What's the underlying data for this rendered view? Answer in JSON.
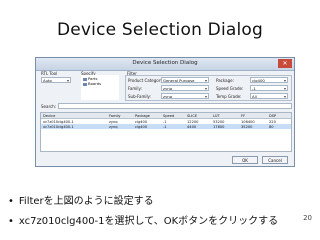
{
  "slide": {
    "title": "Device Selection Dialog",
    "page_number": "20",
    "bullets": [
      "Filterを上図のように設定する",
      "xc7z010clg400-1を選択して、OKボタンをクリックする"
    ]
  },
  "dialog": {
    "title": "Device Selection Dialog",
    "rtl_tool": {
      "label": "RTL Tool",
      "value": "Auto"
    },
    "specify": {
      "label": "Specify",
      "items": [
        "Parts",
        "Boards"
      ]
    },
    "filter": {
      "label": "Filter",
      "product_category": {
        "label": "Product Category:",
        "value": "General Purpose"
      },
      "family": {
        "label": "Family:",
        "value": "zynq"
      },
      "sub_family": {
        "label": "Sub-Family:",
        "value": "zynq"
      },
      "package": {
        "label": "Package:",
        "value": "clg400"
      },
      "speed_grade": {
        "label": "Speed Grade:",
        "value": "-1"
      },
      "temp_grade": {
        "label": "Temp Grade:",
        "value": "All"
      }
    },
    "search": {
      "label": "Search:"
    },
    "table": {
      "columns": [
        "Device",
        "Family",
        "Package",
        "Speed",
        "SLICE",
        "LUT",
        "FF",
        "DSP"
      ],
      "rows": [
        [
          "xc7z010clg400-1",
          "zynq",
          "clg400",
          "-1",
          "12200",
          "53200",
          "106400",
          "220"
        ],
        [
          "xc7z010clg400-1",
          "zynq",
          "clg400",
          "-1",
          "4400",
          "17600",
          "35200",
          "80"
        ]
      ]
    },
    "buttons": {
      "ok": "OK",
      "cancel": "Cancel"
    }
  }
}
